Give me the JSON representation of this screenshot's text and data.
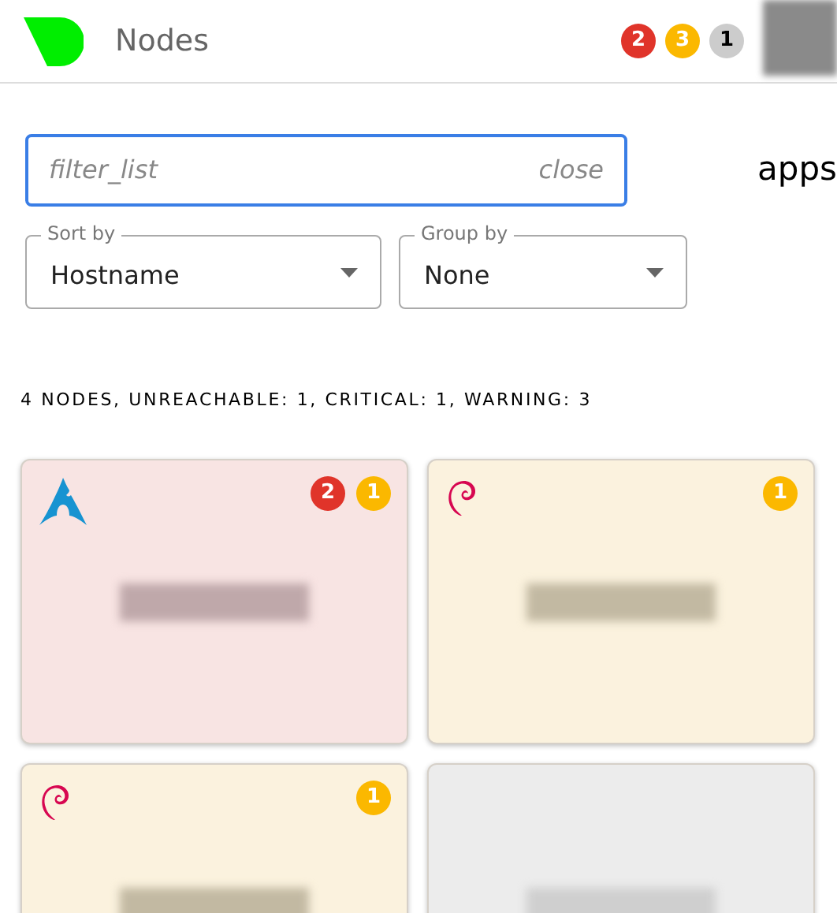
{
  "header": {
    "title": "Nodes",
    "badges": [
      {
        "count": "2",
        "kind": "critical"
      },
      {
        "count": "3",
        "kind": "warning"
      },
      {
        "count": "1",
        "kind": "unreachable"
      }
    ]
  },
  "filter": {
    "leading_icon": "filter_list",
    "trailing_icon": "close",
    "focused": true
  },
  "side_icon": "apps",
  "selects": [
    {
      "label": "Sort by",
      "value": "Hostname"
    },
    {
      "label": "Group by",
      "value": "None"
    }
  ],
  "summary": "4 NODES, UNREACHABLE: 1, CRITICAL: 1, WARNING: 3",
  "nodes": [
    {
      "kind": "critical",
      "logo": {
        "kind": "arch"
      },
      "badges": [
        {
          "count": "2",
          "kind": "critical"
        },
        {
          "count": "1",
          "kind": "warning"
        }
      ]
    },
    {
      "kind": "warning",
      "logo": {
        "kind": "debian"
      },
      "badges": [
        {
          "count": "1",
          "kind": "warning"
        }
      ]
    },
    {
      "kind": "warning",
      "logo": {
        "kind": "debian"
      },
      "badges": [
        {
          "count": "1",
          "kind": "warning"
        }
      ]
    },
    {
      "kind": "unreachable"
    }
  ]
}
